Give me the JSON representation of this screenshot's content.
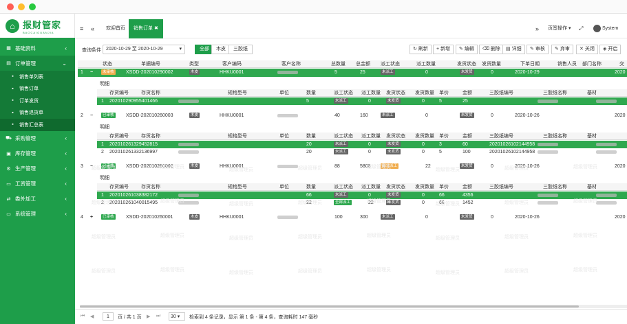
{
  "window_dots": [
    "#ff5f56",
    "#ffbd2e",
    "#27c93f"
  ],
  "logo": {
    "name": "报财管家",
    "sub": "BAOCAIGUANJIA"
  },
  "sidebar": {
    "items": [
      {
        "label": "基础资料",
        "icon": "grid-icon"
      },
      {
        "label": "订单管理",
        "icon": "doc-icon",
        "open": true
      },
      {
        "label": "采购管理",
        "icon": "cart-icon"
      },
      {
        "label": "库存管理",
        "icon": "box-icon"
      },
      {
        "label": "生产管理",
        "icon": "cog-icon"
      },
      {
        "label": "工资管理",
        "icon": "money-icon"
      },
      {
        "label": "委外加工",
        "icon": "share-icon"
      },
      {
        "label": "系统管理",
        "icon": "monitor-icon"
      }
    ],
    "sub_items": [
      "销售单列表",
      "销售订单",
      "订单发货",
      "销售退货单",
      "销售汇总表"
    ]
  },
  "topbar": {
    "tabs": [
      "欢迎首页",
      "销售订单"
    ],
    "page_ops": "页签操作",
    "user": "System"
  },
  "toolbar": {
    "filter_label": "查询条件",
    "date_range": "2020-10-29 至 2020-10-29",
    "segments": [
      "全部",
      "木皮",
      "三胶纸"
    ],
    "buttons": [
      "刷新",
      "新增",
      "编辑",
      "删除",
      "详细",
      "审核",
      "弃审",
      "关闭",
      "开启"
    ]
  },
  "table": {
    "headers": [
      "状态",
      "单据编号",
      "类型",
      "客户编码",
      "客户名称",
      "总数量",
      "总金额",
      "派工状态",
      "派工数量",
      "发货状态",
      "发货数量",
      "下单日期",
      "销售人员",
      "部门名称",
      "交"
    ],
    "detail_label": "明细",
    "detail_headers": [
      "存货编号",
      "存货名称",
      "规格型号",
      "单位",
      "数量",
      "派工状态",
      "派工数量",
      "发货状态",
      "发货数量",
      "单价",
      "金额",
      "三胶纸编号",
      "三胶纸名称",
      "基材"
    ],
    "rows": [
      {
        "no": "1",
        "status": "未审核",
        "code": "XSDD-202010290002",
        "type": "木皮",
        "cust": "HHKU0001",
        "qty": "5",
        "amount": "25",
        "dispatch": "未派工",
        "dqty": "0",
        "ship": "未发货",
        "sqty": "0",
        "date": "2020-10-29",
        "year": "2020",
        "details": [
          {
            "no": "1",
            "code": "202010290955401466",
            "qty": "5",
            "dispatch": "未派工",
            "dqty": "0",
            "ship": "未发货",
            "sqty": "0",
            "price": "5",
            "amount": "25",
            "sj": ""
          }
        ]
      },
      {
        "no": "2",
        "status": "已审核",
        "code": "XSDD-202010260003",
        "type": "木皮",
        "cust": "HHKU0001",
        "qty": "40",
        "amount": "160",
        "dispatch": "未派工",
        "dqty": "0",
        "ship": "未发货",
        "sqty": "0",
        "date": "2020-10-26",
        "year": "2020",
        "details": [
          {
            "no": "1",
            "code": "202010261329452815",
            "qty": "20",
            "dispatch": "未派工",
            "dqty": "0",
            "ship": "未发货",
            "sqty": "0",
            "price": "3",
            "amount": "60",
            "sj": "20201026102144958"
          },
          {
            "no": "2",
            "code": "202010261332136997",
            "qty": "20",
            "dispatch": "未派工",
            "dqty": "0",
            "ship": "未发货",
            "sqty": "0",
            "price": "5",
            "amount": "100",
            "sj": "20201026102144958"
          }
        ]
      },
      {
        "no": "3",
        "status": "已审核",
        "code": "XSDD-202010260002",
        "type": "木皮",
        "cust": "HHKU0001",
        "qty": "88",
        "amount": "5808",
        "dispatch": "部分派工",
        "dqty": "22",
        "ship": "未发货",
        "sqty": "0",
        "date": "2020-10-26",
        "year": "2020",
        "details": [
          {
            "no": "1",
            "code": "202010261038382172",
            "qty": "66",
            "dispatch": "未派工",
            "dqty": "0",
            "ship": "未发货",
            "sqty": "0",
            "price": "66",
            "amount": "4356",
            "sj": ""
          },
          {
            "no": "2",
            "code": "202010261040015495",
            "qty": "22",
            "dispatch": "全部派工",
            "dqty": "22",
            "ship": "未发货",
            "sqty": "0",
            "price": "66",
            "amount": "1452",
            "sj": ""
          }
        ]
      },
      {
        "no": "4",
        "status": "已审核",
        "code": "XSDD-202010260001",
        "type": "木皮",
        "cust": "HHKU0001",
        "qty": "100",
        "amount": "300",
        "dispatch": "未派工",
        "dqty": "0",
        "ship": "未发货",
        "sqty": "0",
        "date": "2020-10-26",
        "year": "2020",
        "details": []
      }
    ]
  },
  "watermark": "超级管理员",
  "footer": {
    "page": "1",
    "page_total": "页 / 共 1 页",
    "page_size": "30",
    "summary": "检索到 4 条记录，显示 第 1 条 - 第 4 条，查询耗时 147 毫秒"
  }
}
